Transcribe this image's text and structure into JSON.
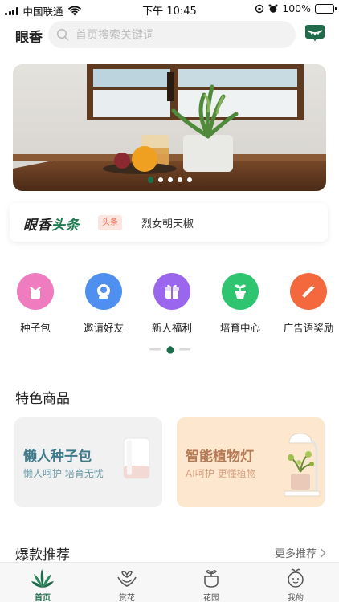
{
  "status_bar": {
    "carrier": "中国联通",
    "time": "下午 10:45",
    "battery": "100%"
  },
  "header": {
    "brand": "眼香",
    "search_placeholder": "首页搜索关键词"
  },
  "banner": {
    "slide_count": 5,
    "active_slide": 1
  },
  "headline": {
    "logo_part1": "眼香",
    "logo_part2": "头条",
    "tag": "头条",
    "text": "烈女朝天椒"
  },
  "shortcuts": [
    {
      "label": "种子包",
      "icon": "seed-pack-icon",
      "color": "#f07cc0"
    },
    {
      "label": "邀请好友",
      "icon": "invite-friend-icon",
      "color": "#4f8ff0"
    },
    {
      "label": "新人福利",
      "icon": "gift-icon",
      "color": "#9a66ee"
    },
    {
      "label": "培育中心",
      "icon": "sprout-pot-icon",
      "color": "#2fc46f"
    },
    {
      "label": "广告语奖励",
      "icon": "megaphone-icon",
      "color": "#f4683e"
    }
  ],
  "featured": {
    "title": "特色商品",
    "cards": [
      {
        "title": "懒人种子包",
        "subtitle": "懒人呵护  培育无忧",
        "title_color": "#3f7a8c",
        "subtitle_color": "#6b9aa8",
        "bg": "#f1f1f1"
      },
      {
        "title": "智能植物灯",
        "subtitle": "AI呵护  更懂植物",
        "title_color": "#b87a55",
        "subtitle_color": "#d7a07f",
        "bg": "#fde8cf"
      }
    ]
  },
  "hot": {
    "title": "爆款推荐",
    "more_label": "更多推荐"
  },
  "tabbar": {
    "tabs": [
      {
        "label": "首页",
        "icon": "home-plant-icon",
        "active": true
      },
      {
        "label": "赏花",
        "icon": "flower-hands-icon",
        "active": false
      },
      {
        "label": "花园",
        "icon": "garden-pot-icon",
        "active": false
      },
      {
        "label": "我的",
        "icon": "profile-face-icon",
        "active": false
      }
    ]
  },
  "colors": {
    "brand_green": "#1f6b4b",
    "tag_red": "#f0705a"
  }
}
